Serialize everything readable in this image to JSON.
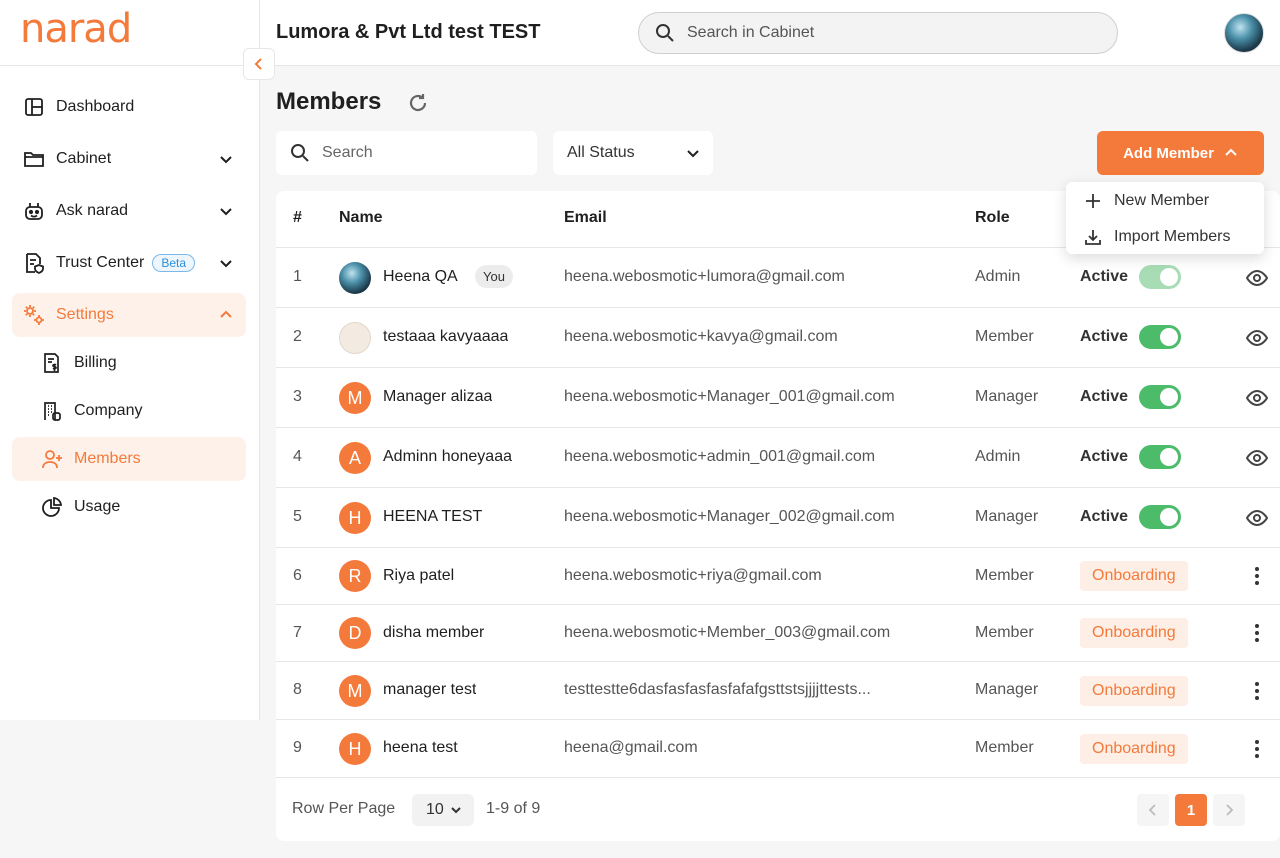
{
  "brand": {
    "logo_text": "narad",
    "accent": "#f47a3b"
  },
  "sidebar": {
    "items": [
      {
        "label": "Dashboard",
        "icon": "dashboard-icon"
      },
      {
        "label": "Cabinet",
        "icon": "folder-icon"
      },
      {
        "label": "Ask narad",
        "icon": "bot-icon"
      },
      {
        "label": "Trust Center",
        "icon": "document-shield-icon",
        "badge": "Beta"
      },
      {
        "label": "Settings",
        "icon": "gears-icon"
      }
    ],
    "sub_items": [
      {
        "label": "Billing",
        "icon": "billing-icon"
      },
      {
        "label": "Company",
        "icon": "company-icon"
      },
      {
        "label": "Members",
        "icon": "user-plus-icon"
      },
      {
        "label": "Usage",
        "icon": "pie-chart-icon"
      }
    ]
  },
  "header": {
    "org_title": "Lumora & Pvt Ltd test TEST",
    "search_placeholder": "Search in Cabinet"
  },
  "page": {
    "title": "Members",
    "search_placeholder": "Search",
    "status_filter": "All Status",
    "add_button": "Add Member",
    "dropdown": [
      "New Member",
      "Import Members"
    ]
  },
  "table": {
    "headers": [
      "#",
      "Name",
      "Email",
      "Role"
    ],
    "rows": [
      {
        "num": "1",
        "initial": "",
        "name": "Heena QA",
        "badge": "You",
        "email": "heena.webosmotic+lumora@gmail.com",
        "role": "Admin",
        "status": "Active"
      },
      {
        "num": "2",
        "initial": "",
        "name": "testaaa kavyaaaa",
        "email": "heena.webosmotic+kavya@gmail.com",
        "role": "Member",
        "status": "Active"
      },
      {
        "num": "3",
        "initial": "M",
        "name": "Manager alizaa",
        "email": "heena.webosmotic+Manager_001@gmail.com",
        "role": "Manager",
        "status": "Active"
      },
      {
        "num": "4",
        "initial": "A",
        "name": "Adminn honeyaaa",
        "email": "heena.webosmotic+admin_001@gmail.com",
        "role": "Admin",
        "status": "Active"
      },
      {
        "num": "5",
        "initial": "H",
        "name": "HEENA TEST",
        "email": "heena.webosmotic+Manager_002@gmail.com",
        "role": "Manager",
        "status": "Active"
      },
      {
        "num": "6",
        "initial": "R",
        "name": "Riya patel",
        "email": "heena.webosmotic+riya@gmail.com",
        "role": "Member",
        "status": "Onboarding"
      },
      {
        "num": "7",
        "initial": "D",
        "name": "disha member",
        "email": "heena.webosmotic+Member_003@gmail.com",
        "role": "Member",
        "status": "Onboarding"
      },
      {
        "num": "8",
        "initial": "M",
        "name": "manager test",
        "email": "testtestte6dasfasfasfasfafafgsttstsjjjjttests...",
        "role": "Manager",
        "status": "Onboarding"
      },
      {
        "num": "9",
        "initial": "H",
        "name": "heena test",
        "email": "heena@gmail.com",
        "role": "Member",
        "status": "Onboarding"
      }
    ]
  },
  "footer": {
    "rows_label": "Row Per Page",
    "rows_value": "10",
    "range": "1-9 of 9",
    "current_page": "1"
  }
}
